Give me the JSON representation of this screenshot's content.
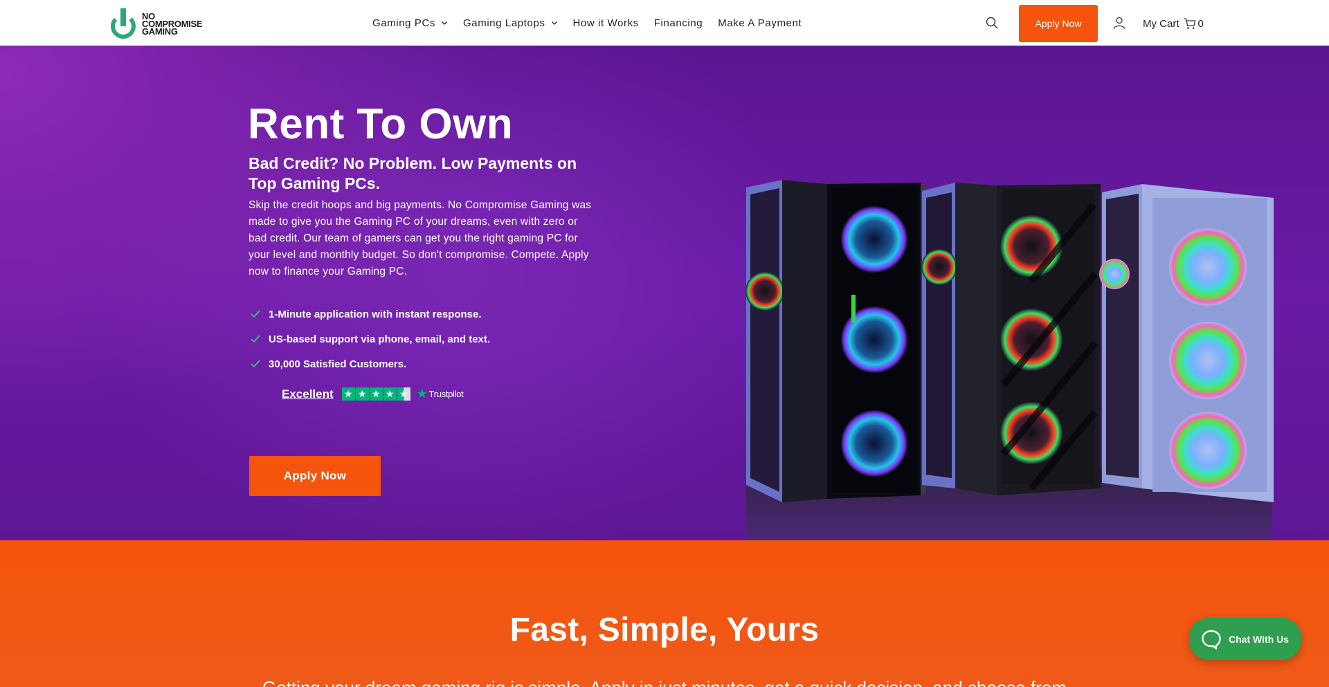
{
  "header": {
    "logo": {
      "line1": "NO",
      "line2": "COMPROMISE",
      "line3": "GAMING",
      "icon": "power-icon"
    },
    "nav": [
      {
        "label": "Gaming PCs",
        "has_dropdown": true
      },
      {
        "label": "Gaming Laptops",
        "has_dropdown": true
      },
      {
        "label": "How it Works",
        "has_dropdown": false
      },
      {
        "label": "Financing",
        "has_dropdown": false
      },
      {
        "label": "Make A Payment",
        "has_dropdown": false
      }
    ],
    "search_icon": "search-icon",
    "apply_label": "Apply Now",
    "user_icon": "user-icon",
    "cart": {
      "label": "My Cart",
      "icon": "cart-icon",
      "count": "0"
    }
  },
  "hero": {
    "title": "Rent To Own",
    "subtitle": "Bad Credit? No Problem. Low Payments on Top Gaming PCs.",
    "description": "Skip the credit hoops and big payments. No Compromise Gaming was made to give you the Gaming PC of your dreams, even with zero or bad credit. Our team of gamers can get you the right gaming PC for your level and monthly budget. So don't compromise. Compete. Apply now to finance your Gaming PC.",
    "features": [
      "1-Minute application with instant response.",
      "US-based support via phone, email, and text.",
      "30,000 Satisfied Customers."
    ],
    "trustpilot": {
      "rating_word": "Excellent",
      "stars": 4.5,
      "brand": "Trustpilot"
    },
    "apply_label": "Apply Now",
    "image_alt": "gaming-pc-towers"
  },
  "section2": {
    "title": "Fast, Simple, Yours",
    "text": "Getting your dream gaming rig is simple. Apply in just minutes, get a quick decision, and choose from"
  },
  "chat": {
    "label": "Chat With Us",
    "icon": "chat-bubble-icon"
  },
  "colors": {
    "accent_orange": "#f4540b",
    "hero_purple": "#6a1aa6",
    "brand_green": "#2fa877",
    "chat_green": "#2e9e4f",
    "trustpilot_green": "#00b67a"
  }
}
